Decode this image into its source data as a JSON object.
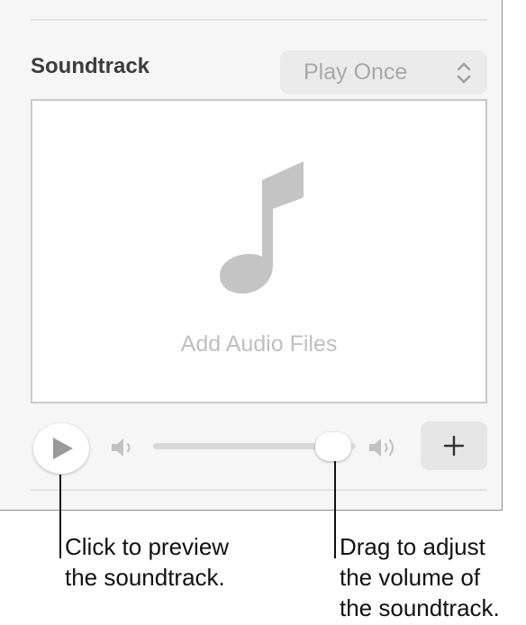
{
  "soundtrack": {
    "title": "Soundtrack",
    "mode_value": "Play Once",
    "drop_label": "Add Audio Files",
    "volume_level": 0.88
  },
  "icons": {
    "play": "play-icon",
    "volume_low": "speaker-low-icon",
    "volume_high": "speaker-high-icon",
    "add": "plus-icon",
    "note": "music-note-icon",
    "select": "chevron-up-down-icon"
  },
  "callouts": {
    "preview_line1": "Click to preview",
    "preview_line2": "the soundtrack.",
    "volume_line1": "Drag to adjust",
    "volume_line2": "the volume of",
    "volume_line3": "the soundtrack."
  },
  "colors": {
    "panel_bg": "#f6f6f6",
    "muted_text": "#a8a8a8",
    "note_gray": "#c4c4c4"
  }
}
